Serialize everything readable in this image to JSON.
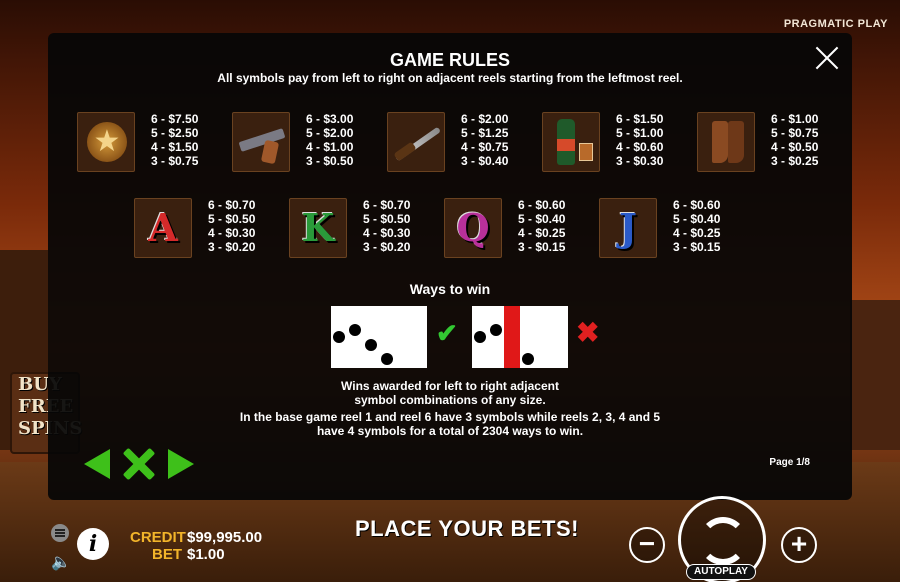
{
  "brand": "PRAGMATIC PLAY",
  "background": {
    "buy_sign_lines": [
      "BUY",
      "FREE",
      "SPINS"
    ]
  },
  "dialog": {
    "title": "GAME RULES",
    "subtitle": "All symbols pay from left to right on adjacent reels starting from the leftmost reel.",
    "symbols_row1": [
      {
        "icon": "sheriff-badge",
        "pays": [
          "6 - $7.50",
          "5 - $2.50",
          "4 - $1.50",
          "3 - $0.75"
        ]
      },
      {
        "icon": "revolver",
        "pays": [
          "6 - $3.00",
          "5 - $2.00",
          "4 - $1.00",
          "3 - $0.50"
        ]
      },
      {
        "icon": "knife",
        "pays": [
          "6 - $2.00",
          "5 - $1.25",
          "4 - $0.75",
          "3 - $0.40"
        ]
      },
      {
        "icon": "whiskey-bottle",
        "pays": [
          "6 - $1.50",
          "5 - $1.00",
          "4 - $0.60",
          "3 - $0.30"
        ]
      },
      {
        "icon": "cowboy-boots",
        "pays": [
          "6 - $1.00",
          "5 - $0.75",
          "4 - $0.50",
          "3 - $0.25"
        ]
      }
    ],
    "symbols_row2": [
      {
        "letter": "A",
        "color": "#d42a2a",
        "pays": [
          "6 - $0.70",
          "5 - $0.50",
          "4 - $0.30",
          "3 - $0.20"
        ]
      },
      {
        "letter": "K",
        "color": "#2a9a3a",
        "pays": [
          "6 - $0.70",
          "5 - $0.50",
          "4 - $0.30",
          "3 - $0.20"
        ]
      },
      {
        "letter": "Q",
        "color": "#b8309a",
        "pays": [
          "6 - $0.60",
          "5 - $0.40",
          "4 - $0.25",
          "3 - $0.15"
        ]
      },
      {
        "letter": "J",
        "color": "#2a5ac8",
        "pays": [
          "6 - $0.60",
          "5 - $0.40",
          "4 - $0.25",
          "3 - $0.15"
        ]
      }
    ],
    "ways_title": "Ways to win",
    "desc_line1": "Wins awarded for left to right adjacent",
    "desc_line2": "symbol combinations of any size.",
    "desc_line3": "In the base game reel 1 and reel 6 have 3 symbols while reels 2, 3, 4 and 5",
    "desc_line4": "have 4  symbols for a total of 2304 ways to win.",
    "page": "Page 1/8"
  },
  "bottom": {
    "credit_label": "CREDIT",
    "credit_value": "$99,995.00",
    "bet_label": "BET",
    "bet_value": "$1.00",
    "message": "PLACE YOUR BETS!",
    "minus": "−",
    "plus": "+",
    "autoplay": "AUTOPLAY",
    "info": "i"
  },
  "colors": {
    "accent_green": "#3ec01a",
    "label_gold": "#f2b42a",
    "error_red": "#e02020"
  }
}
